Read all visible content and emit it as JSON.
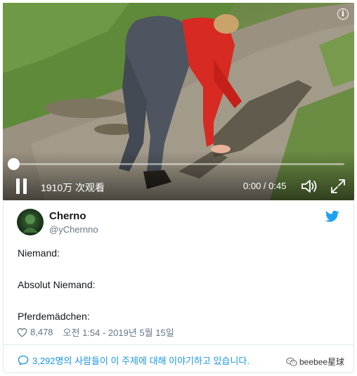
{
  "video": {
    "views": "1910万 次观看",
    "time": "0:00 / 0:45",
    "progress_fraction": 0.0,
    "icons": {
      "info": "info-icon",
      "play_pause": "pause-icon",
      "volume": "volume-icon",
      "fullscreen": "fullscreen-icon"
    },
    "info_glyph": "i"
  },
  "tweet": {
    "display_name": "Cherno",
    "handle": "@yChernno",
    "lines": [
      "Niemand:",
      "Absolut Niemand:",
      "Pferdemädchen:"
    ],
    "like_count": "8,478",
    "timestamp": "오전 1:54 - 2019년 5월 15일",
    "conversation": "3,292명의 사람들이 이 주제에 대해 이야기하고 있습니다.",
    "icons": {
      "avatar": "avatar",
      "brand": "twitter-bird-icon",
      "like": "heart-icon",
      "conversation": "speech-bubble-icon"
    }
  },
  "watermark": {
    "text": "beebee星球",
    "icon": "wechat-icon"
  },
  "colors": {
    "twitter_blue": "#1da1f2",
    "link_blue": "#1b95e0",
    "secondary_text": "#657786",
    "border": "#e1e8ed"
  }
}
